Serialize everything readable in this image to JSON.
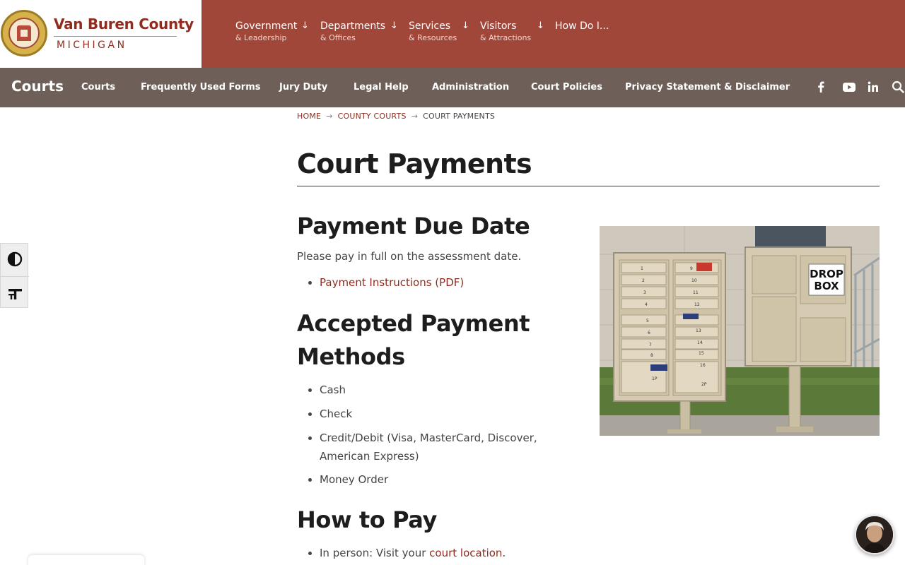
{
  "header": {
    "county_name": "Van Buren County",
    "state": "MICHIGAN",
    "logo_icon": "county-seal-icon",
    "nav": [
      {
        "title": "Government",
        "subtitle": "& Leadership",
        "has_dropdown": true
      },
      {
        "title": "Departments",
        "subtitle": "& Offices",
        "has_dropdown": true
      },
      {
        "title": "Services",
        "subtitle": "& Resources",
        "has_dropdown": true
      },
      {
        "title": "Visitors",
        "subtitle": "& Attractions",
        "has_dropdown": true
      },
      {
        "title": "How Do I...",
        "subtitle": "",
        "has_dropdown": false
      }
    ],
    "bg_color": "#a0473a"
  },
  "subnav": {
    "title": "Courts",
    "links": [
      "Courts",
      "Frequently Used Forms",
      "Jury Duty",
      "Legal Help",
      "Administration",
      "Court Policies",
      "Privacy Statement & Disclaimer"
    ],
    "social_icons": [
      "facebook-icon",
      "youtube-icon",
      "linkedin-icon",
      "search-icon"
    ],
    "bg_color": "#6e6059"
  },
  "accessibility": {
    "buttons": [
      "contrast-toggle-icon",
      "font-size-icon"
    ]
  },
  "breadcrumb": {
    "items": [
      "HOME",
      "COUNTY COURTS",
      "COURT PAYMENTS"
    ],
    "separator": "→"
  },
  "content": {
    "page_title": "Court Payments",
    "sections": {
      "due_date": {
        "heading": "Payment Due Date",
        "text": "Please pay in full on the assessment date.",
        "links": [
          "Payment Instructions (PDF)"
        ]
      },
      "methods": {
        "heading_line1": "Accepted Payment",
        "heading_line2": "Methods",
        "items": [
          "Cash",
          "Check",
          "Credit/Debit (Visa, MasterCard, Discover,",
          "American Express)",
          "Money Order"
        ]
      },
      "how_to_pay": {
        "heading": "How to Pay",
        "item_prefix": "In person: Visit your ",
        "item_link": "court location",
        "item_suffix": "."
      }
    },
    "photo": {
      "mailbox_numbers_left": [
        "1",
        "2",
        "3",
        "4",
        "5",
        "6",
        "7",
        "8",
        "1P"
      ],
      "mailbox_numbers_right": [
        "9",
        "10",
        "11",
        "12",
        "13",
        "14",
        "15",
        "16",
        "2P"
      ],
      "sign_line1": "DROP",
      "sign_line2": "BOX"
    }
  },
  "colors": {
    "accent": "#8e2d1f",
    "text": "#444444"
  }
}
